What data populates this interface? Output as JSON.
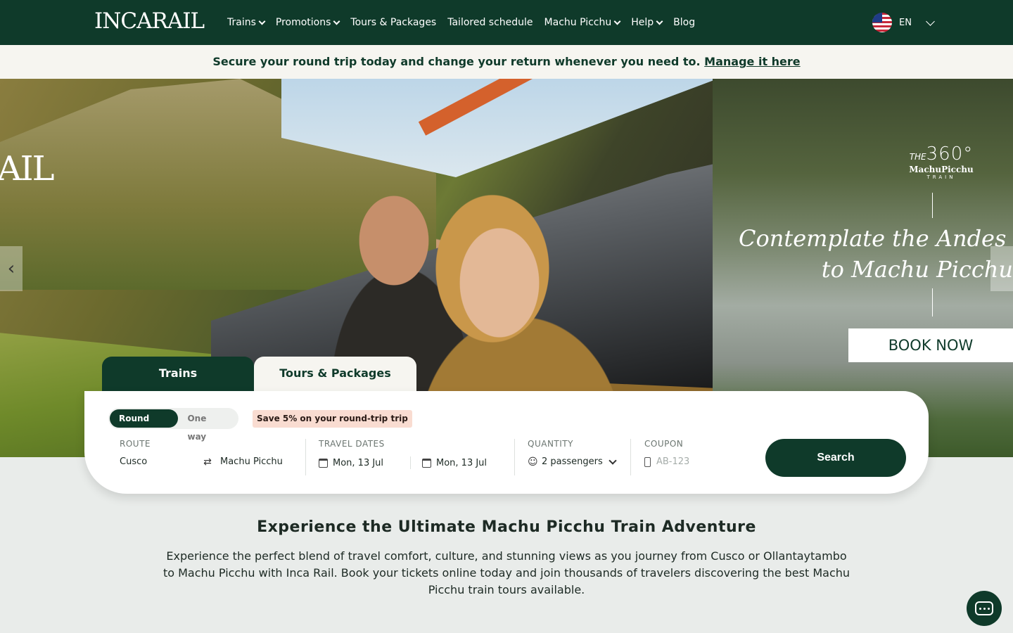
{
  "header": {
    "logo": "INCARAIL",
    "nav": [
      {
        "label": "Trains",
        "dropdown": true
      },
      {
        "label": "Promotions",
        "dropdown": true
      },
      {
        "label": "Tours & Packages",
        "dropdown": false
      },
      {
        "label": "Tailored schedule",
        "dropdown": false
      },
      {
        "label": "Machu Picchu",
        "dropdown": true
      },
      {
        "label": "Help",
        "dropdown": true
      },
      {
        "label": "Blog",
        "dropdown": false
      }
    ],
    "language": "EN"
  },
  "banner": {
    "text": "Secure your round trip today and change your return whenever you need to.",
    "link": "Manage it here"
  },
  "hero": {
    "logo_fragment": "AIL",
    "brand": {
      "prefix": "THE",
      "number": "360°",
      "name": "MachuPicchu",
      "sub": "TRAIN"
    },
    "headline_1": "Contemplate the Andes on",
    "headline_2": "to Machu Picchu",
    "cta": "BOOK NOW"
  },
  "booking": {
    "tabs": [
      "Trains",
      "Tours & Packages"
    ],
    "trip_types": [
      "Round trip",
      "One way"
    ],
    "save_badge": "Save 5% on your round-trip trip",
    "route": {
      "label": "ROUTE",
      "from": "Cusco",
      "to": "Machu Picchu"
    },
    "dates": {
      "label": "TRAVEL DATES",
      "departure": "Mon, 13 Jul",
      "return": "Mon, 13 Jul"
    },
    "quantity": {
      "label": "QUANTITY",
      "value": "2 passengers"
    },
    "coupon": {
      "label": "COUPON",
      "placeholder": "AB-123"
    },
    "search": "Search"
  },
  "intro": {
    "title": "Experience the Ultimate Machu Picchu Train Adventure",
    "text": "Experience the perfect blend of travel comfort, culture, and stunning views as you journey from Cusco or Ollantaytambo to Machu Picchu with Inca Rail. Book your tickets online today and join thousands of travelers discovering the best Machu Picchu train tours available."
  },
  "colors": {
    "primary": "#0f3a2a",
    "banner_bg": "#f6f5f0",
    "badge_bg": "#f9dcd1",
    "page_bg": "#e9ecea"
  }
}
